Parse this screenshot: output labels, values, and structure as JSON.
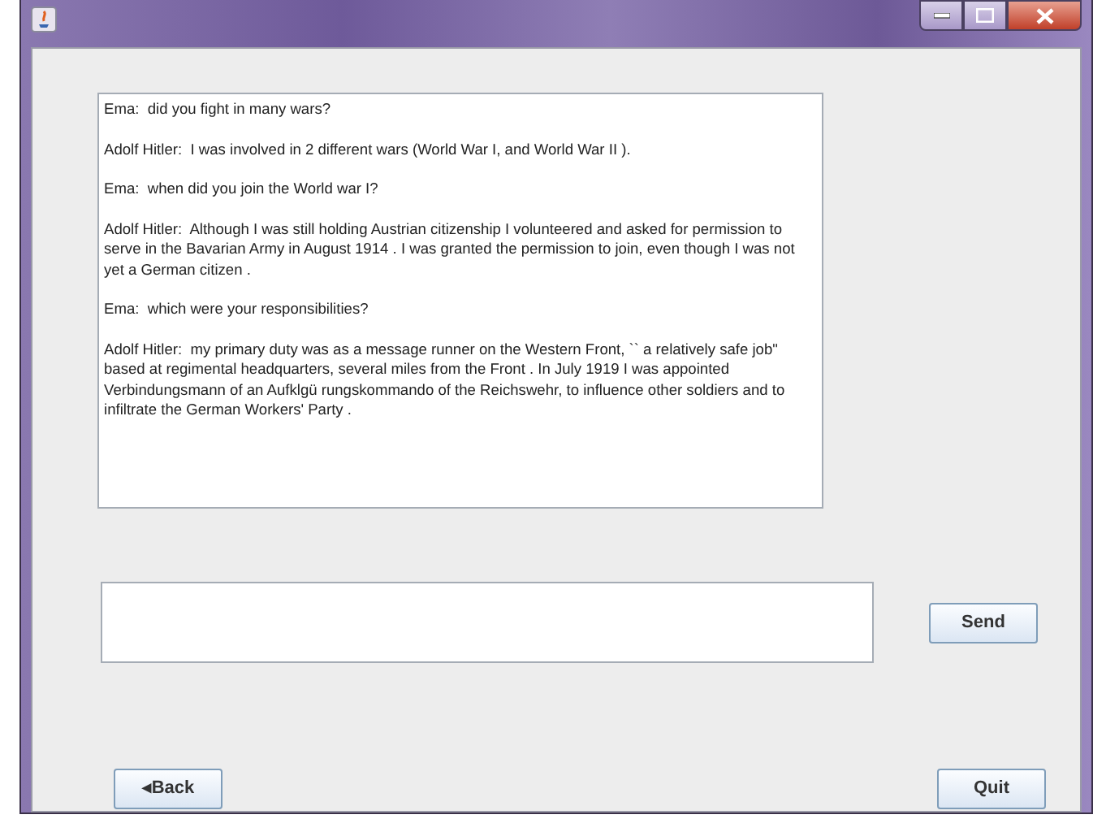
{
  "transcript": [
    {
      "text": "Ema:  did you fight in many wars?"
    },
    {
      "text": "Adolf Hitler:  I was involved in 2 different wars (World War I, and World War II )."
    },
    {
      "text": "Ema:  when did you join the World war I?"
    },
    {
      "text": "Adolf Hitler:  Although I was still holding Austrian citizenship I volunteered and asked for permission to serve in the Bavarian Army in August 1914 . I was granted the permission to join, even though I was not yet a German citizen ."
    },
    {
      "text": "Ema:  which were your responsibilities?"
    },
    {
      "text": "Adolf Hitler:  my primary duty was as a message runner on the Western Front, `` a relatively safe job\" based at regimental headquarters, several miles from the Front . In July 1919 I was appointed Verbindungsmann of an Aufklgü rungskommando of the Reichswehr, to influence other soldiers and to infiltrate the German Workers' Party ."
    }
  ],
  "send_button": "Send",
  "back_button": "◂Back",
  "quit_button": "Quit"
}
